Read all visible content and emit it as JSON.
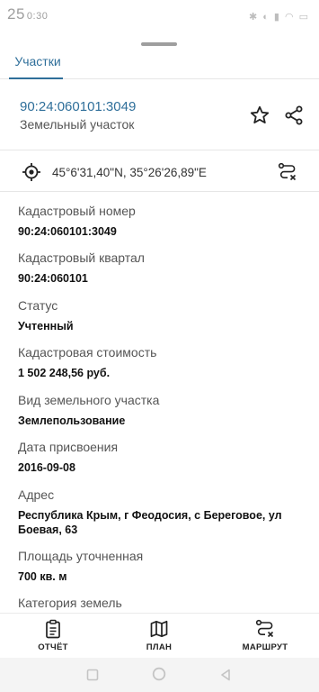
{
  "status_bar": {
    "time": "25",
    "time_suffix": "0:30"
  },
  "tabs": [
    {
      "label": "Участки"
    }
  ],
  "parcel": {
    "number": "90:24:060101:3049",
    "type": "Земельный участок"
  },
  "coords": {
    "text": "45°6'31,40\"N, 35°26'26,89\"E"
  },
  "fields": [
    {
      "label": "Кадастровый номер",
      "value": "90:24:060101:3049"
    },
    {
      "label": "Кадастровый квартал",
      "value": "90:24:060101"
    },
    {
      "label": "Статус",
      "value": "Учтенный"
    },
    {
      "label": "Кадастровая стоимость",
      "value": "1 502 248,56 руб."
    },
    {
      "label": "Вид земельного участка",
      "value": "Землепользование"
    },
    {
      "label": "Дата присвоения",
      "value": "2016-09-08"
    },
    {
      "label": "Адрес",
      "value": "Республика Крым, г Феодосия, с Береговое, ул Боевая, 63"
    },
    {
      "label": "Площадь уточненная",
      "value": "700 кв. м"
    },
    {
      "label": "Категория земель",
      "value": ""
    }
  ],
  "bottom_nav": [
    {
      "label": "ОТЧЁТ",
      "icon": "report-icon"
    },
    {
      "label": "ПЛАН",
      "icon": "map-icon"
    },
    {
      "label": "МАРШРУТ",
      "icon": "route-icon"
    }
  ],
  "colors": {
    "accent": "#2f6f9a",
    "text": "#111111",
    "muted": "#555555"
  }
}
